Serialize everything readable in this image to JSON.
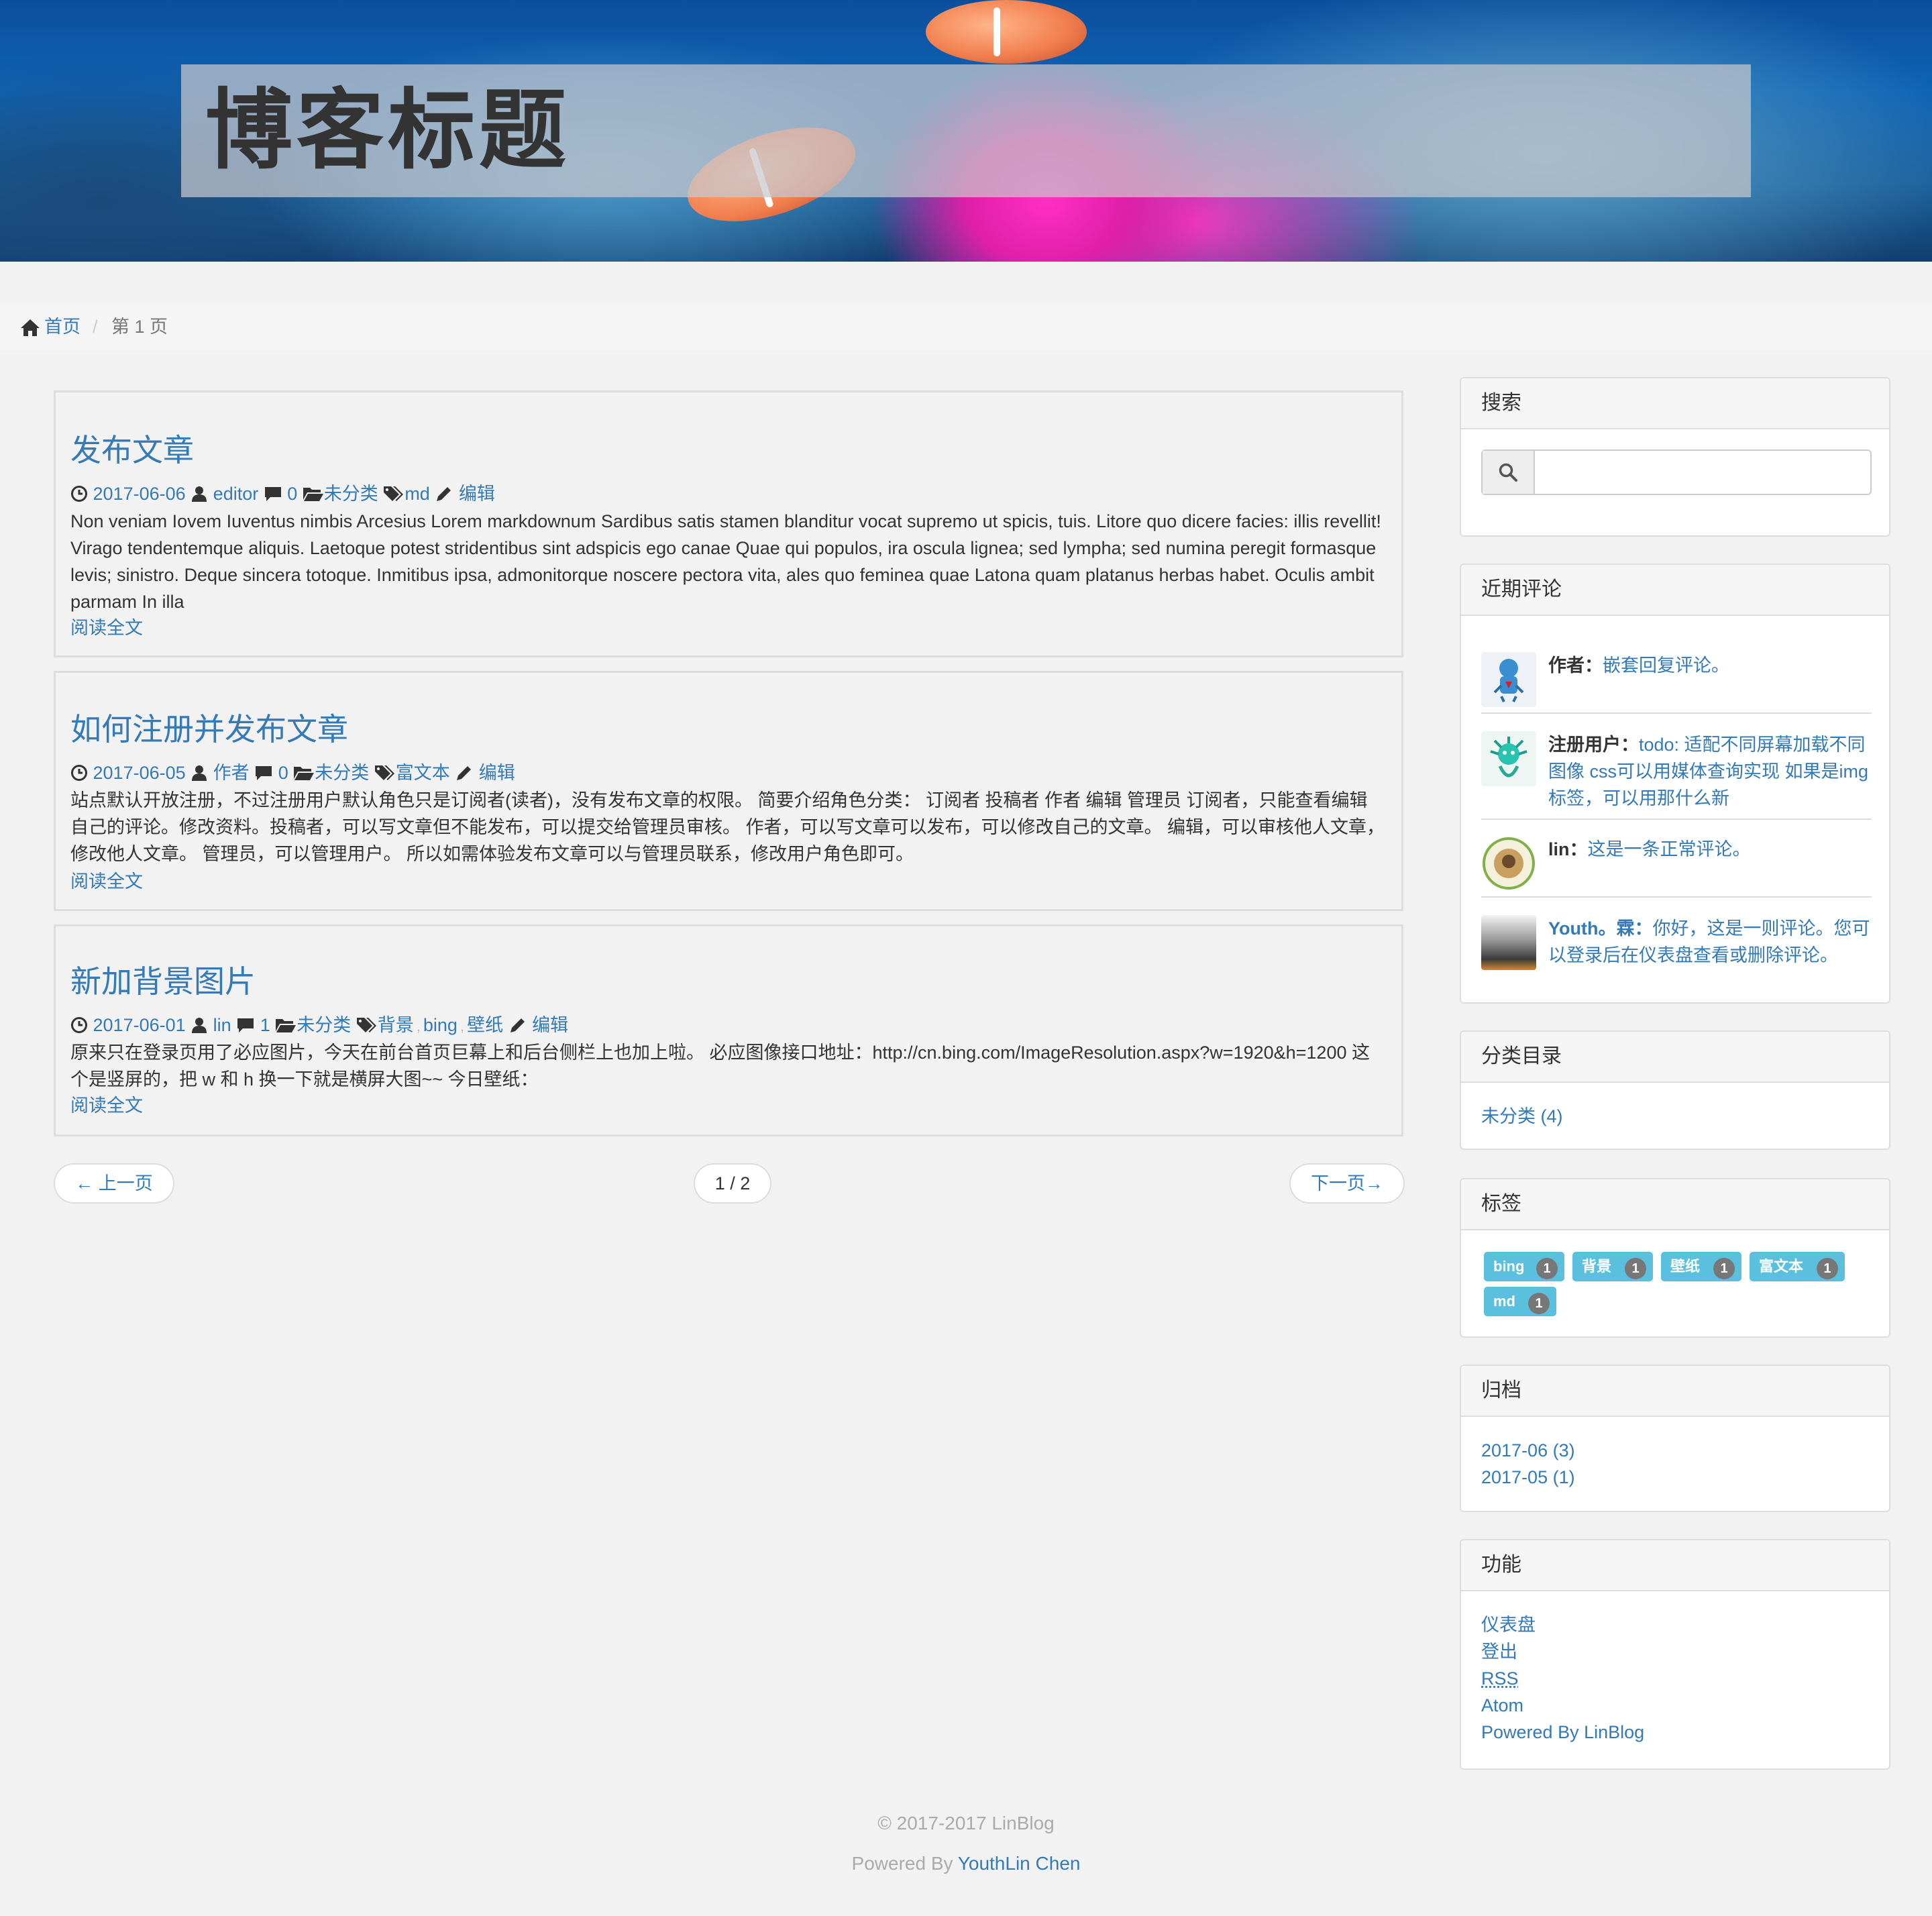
{
  "header": {
    "title": "博客标题"
  },
  "breadcrumb": {
    "home": "首页",
    "separator": "/",
    "current": "第 1 页"
  },
  "posts": [
    {
      "title": "发布文章",
      "date": "2017-06-06",
      "author": "editor",
      "comments": "0",
      "category": "未分类",
      "tags": [
        "md"
      ],
      "edit": "编辑",
      "excerpt": "Non veniam Iovem Iuventus nimbis Arcesius Lorem markdownum Sardibus satis stamen blanditur vocat supremo ut spicis, tuis. Litore quo dicere facies: illis revellit! Virago tendentemque aliquis. Laetoque potest stridentibus sint adspicis ego canae Quae qui populos, ira oscula lignea; sed lympha; sed numina peregit formasque levis; sinistro. Deque sincera totoque. Inmitibus ipsa, admonitorque noscere pectora vita, ales quo feminea quae Latona quam platanus herbas habet. Oculis ambit parmam In illa",
      "read_more": "阅读全文"
    },
    {
      "title": "如何注册并发布文章",
      "date": "2017-06-05",
      "author": "作者",
      "comments": "0",
      "category": "未分类",
      "tags": [
        "富文本"
      ],
      "edit": "编辑",
      "excerpt": "站点默认开放注册，不过注册用户默认角色只是订阅者(读者)，没有发布文章的权限。 简要介绍角色分类： 订阅者 投稿者 作者 编辑 管理员 订阅者，只能查看编辑自己的评论。修改资料。投稿者，可以写文章但不能发布，可以提交给管理员审核。 作者，可以写文章可以发布，可以修改自己的文章。 编辑，可以审核他人文章，修改他人文章。 管理员，可以管理用户。 所以如需体验发布文章可以与管理员联系，修改用户角色即可。",
      "read_more": "阅读全文"
    },
    {
      "title": "新加背景图片",
      "date": "2017-06-01",
      "author": "lin",
      "comments": "1",
      "category": "未分类",
      "tags": [
        "背景",
        "bing",
        "壁纸"
      ],
      "edit": "编辑",
      "excerpt": "原来只在登录页用了必应图片，今天在前台首页巨幕上和后台侧栏上也加上啦。 必应图像接口地址：http://cn.bing.com/ImageResolution.aspx?w=1920&h=1200 这个是竖屏的，把 w 和 h 换一下就是横屏大图~~ 今日壁纸：",
      "read_more": "阅读全文"
    }
  ],
  "pager": {
    "prev": "← 上一页",
    "current": "1 / 2",
    "next": "下一页→"
  },
  "sidebar": {
    "search": {
      "heading": "搜索",
      "placeholder": ""
    },
    "recent_comments": {
      "heading": "近期评论",
      "items": [
        {
          "author": "作者：",
          "text": "嵌套回复评论。"
        },
        {
          "author": "注册用户：",
          "text": "todo: 适配不同屏幕加载不同图像 css可以用媒体查询实现 如果是img 标签，可以用那什么新"
        },
        {
          "author": "lin：",
          "text": "这是一条正常评论。"
        },
        {
          "author": "Youth。霖：",
          "text": "你好，这是一则评论。您可以登录后在仪表盘查看或删除评论。"
        }
      ]
    },
    "categories": {
      "heading": "分类目录",
      "items": [
        "未分类 (4)"
      ]
    },
    "tags": {
      "heading": "标签",
      "items": [
        {
          "label": "bing",
          "count": "1"
        },
        {
          "label": "背景",
          "count": "1"
        },
        {
          "label": "壁纸",
          "count": "1"
        },
        {
          "label": "富文本",
          "count": "1"
        },
        {
          "label": "md",
          "count": "1"
        }
      ]
    },
    "archives": {
      "heading": "归档",
      "items": [
        "2017-06 (3)",
        "2017-05 (1)"
      ]
    },
    "functions": {
      "heading": "功能",
      "items": [
        "仪表盘",
        "登出",
        "RSS",
        "Atom",
        "Powered By LinBlog"
      ]
    }
  },
  "footer": {
    "copyright": "© 2017-2017 LinBlog",
    "powered_prefix": "Powered By ",
    "powered_link": "YouthLin Chen"
  },
  "colors": {
    "link": "#337ab7",
    "tag": "#5bc0de",
    "badge": "#777777"
  },
  "icons": [
    "home-icon",
    "clock-icon",
    "user-icon",
    "comment-icon",
    "folder-icon",
    "tags-icon",
    "pencil-icon",
    "search-icon"
  ]
}
